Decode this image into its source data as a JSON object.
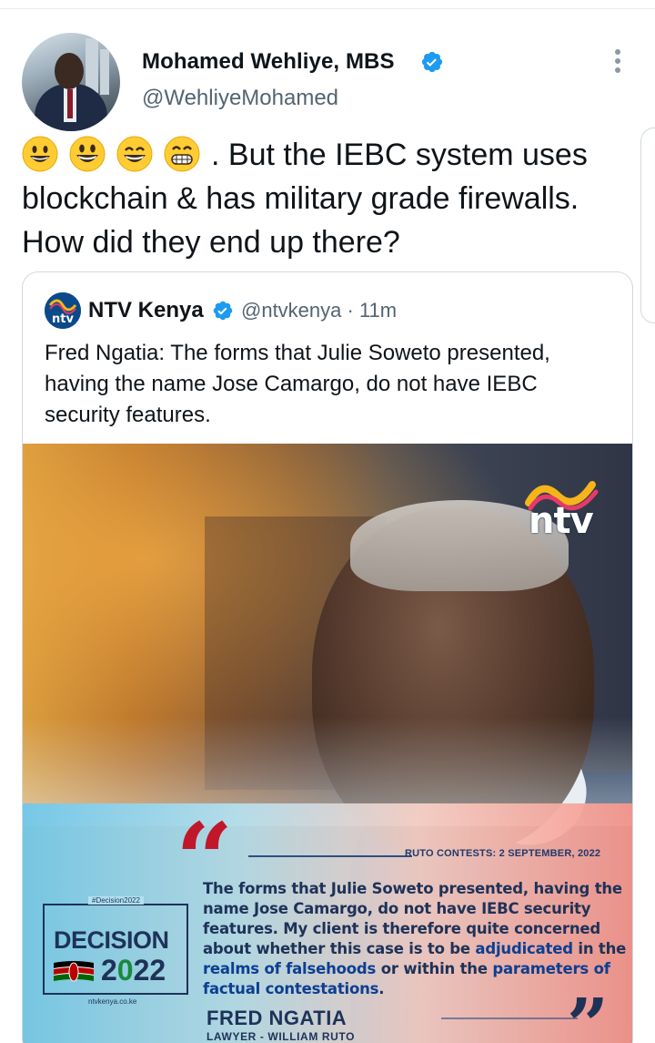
{
  "tweet": {
    "author_name": "Mohamed Wehliye, MBS",
    "author_handle": "@WehliyeMohamed",
    "text": ".  But the IEBC system uses blockchain & has military grade firewalls. How did they end up there?",
    "emojis": [
      "grinning-face",
      "grinning-face-big-eyes",
      "grinning-face-smiling-eyes",
      "beaming-face"
    ]
  },
  "quoted": {
    "author_name": "NTV Kenya",
    "author_handle": "@ntvkenya",
    "time": "· 11m",
    "text": "Fred Ngatia: The forms that Julie Soweto presented, having the name Jose Camargo, do not have IEBC security features."
  },
  "graphic": {
    "logo_text": "ntv",
    "ruto_line": "RUTO CONTESTS: 2 SEPTEMBER, 2022",
    "quote_part1": "The forms that Julie Soweto presented, having the name Jose Camargo, do not have IEBC security features. My client is therefore quite concerned about whether this case is to be ",
    "quote_hl1": "adjudicated",
    "quote_part2": " in the ",
    "quote_hl2": "realms of falsehoods",
    "quote_part3": " or within the ",
    "quote_hl3": "parameters of factual contestations",
    "quote_part4": ".",
    "speaker": "FRED NGATIA",
    "speaker_role": "LAWYER - WILLIAM RUTO",
    "decision_tag": "#Decision2022",
    "decision_word": "DECISION",
    "decision_year_a": "2",
    "decision_year_b": "0",
    "decision_year_c": "22",
    "decision_site": "ntvkenya.co.ke"
  },
  "colors": {
    "verified": "#1d9bf0",
    "secondary_text": "#536471",
    "quote_mark": "#c0182a",
    "navy": "#1e3258"
  }
}
